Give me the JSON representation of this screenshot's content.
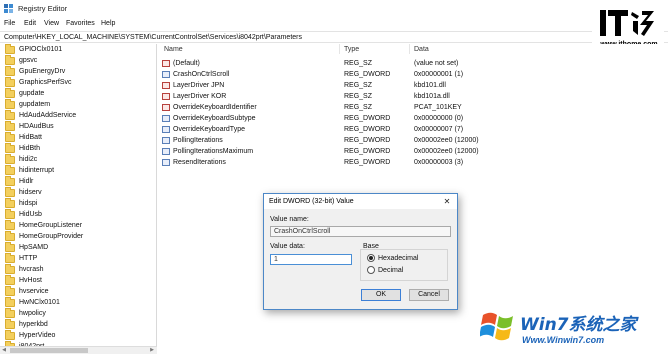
{
  "window": {
    "title": "Registry Editor"
  },
  "menu": [
    "File",
    "Edit",
    "View",
    "Favorites",
    "Help"
  ],
  "address": "Computer\\HKEY_LOCAL_MACHINE\\SYSTEM\\CurrentControlSet\\Services\\i8042prt\\Parameters",
  "watermark": {
    "ithome_url": "www.ithome.com",
    "win7_brand": "Win7系统之家",
    "win7_url": "Www.Winwin7.com"
  },
  "tree": {
    "items": [
      "GPIOClx0101",
      "gpsvc",
      "GpuEnergyDrv",
      "GraphicsPerfSvc",
      "gupdate",
      "gupdatem",
      "HdAudAddService",
      "HDAudBus",
      "HidBatt",
      "HidBth",
      "hidi2c",
      "hidinterrupt",
      "Hidlr",
      "hidserv",
      "hidspi",
      "HidUsb",
      "HomeGroupListener",
      "HomeGroupProvider",
      "HpSAMD",
      "HTTP",
      "hvcrash",
      "HvHost",
      "hvservice",
      "HwNClx0101",
      "hwpolicy",
      "hyperkbd",
      "HyperVideo",
      "i8042prt"
    ]
  },
  "values": {
    "columns": {
      "name": "Name",
      "type": "Type",
      "data": "Data"
    },
    "rows": [
      {
        "name": "(Default)",
        "type": "REG_SZ",
        "data": "(value not set)",
        "icon": "string-value-icon"
      },
      {
        "name": "CrashOnCtrlScroll",
        "type": "REG_DWORD",
        "data": "0x00000001 (1)",
        "icon": "binary-value-icon"
      },
      {
        "name": "LayerDriver JPN",
        "type": "REG_SZ",
        "data": "kbd101.dll",
        "icon": "string-value-icon"
      },
      {
        "name": "LayerDriver KOR",
        "type": "REG_SZ",
        "data": "kbd101a.dll",
        "icon": "string-value-icon"
      },
      {
        "name": "OverrideKeyboardIdentifier",
        "type": "REG_SZ",
        "data": "PCAT_101KEY",
        "icon": "string-value-icon"
      },
      {
        "name": "OverrideKeyboardSubtype",
        "type": "REG_DWORD",
        "data": "0x00000000 (0)",
        "icon": "binary-value-icon"
      },
      {
        "name": "OverrideKeyboardType",
        "type": "REG_DWORD",
        "data": "0x00000007 (7)",
        "icon": "binary-value-icon"
      },
      {
        "name": "PollingIterations",
        "type": "REG_DWORD",
        "data": "0x00002ee0 (12000)",
        "icon": "binary-value-icon"
      },
      {
        "name": "PollingIterationsMaximum",
        "type": "REG_DWORD",
        "data": "0x00002ee0 (12000)",
        "icon": "binary-value-icon"
      },
      {
        "name": "ResendIterations",
        "type": "REG_DWORD",
        "data": "0x00000003 (3)",
        "icon": "binary-value-icon"
      }
    ]
  },
  "dialog": {
    "title": "Edit DWORD (32-bit) Value",
    "close_glyph": "✕",
    "value_name_label": "Value name:",
    "value_name": "CrashOnCtrlScroll",
    "value_data_label": "Value data:",
    "value_data": "1",
    "base_label": "Base",
    "base_options": [
      "Hexadecimal",
      "Decimal"
    ],
    "base_selected": "Hexadecimal",
    "ok_label": "OK",
    "cancel_label": "Cancel"
  }
}
